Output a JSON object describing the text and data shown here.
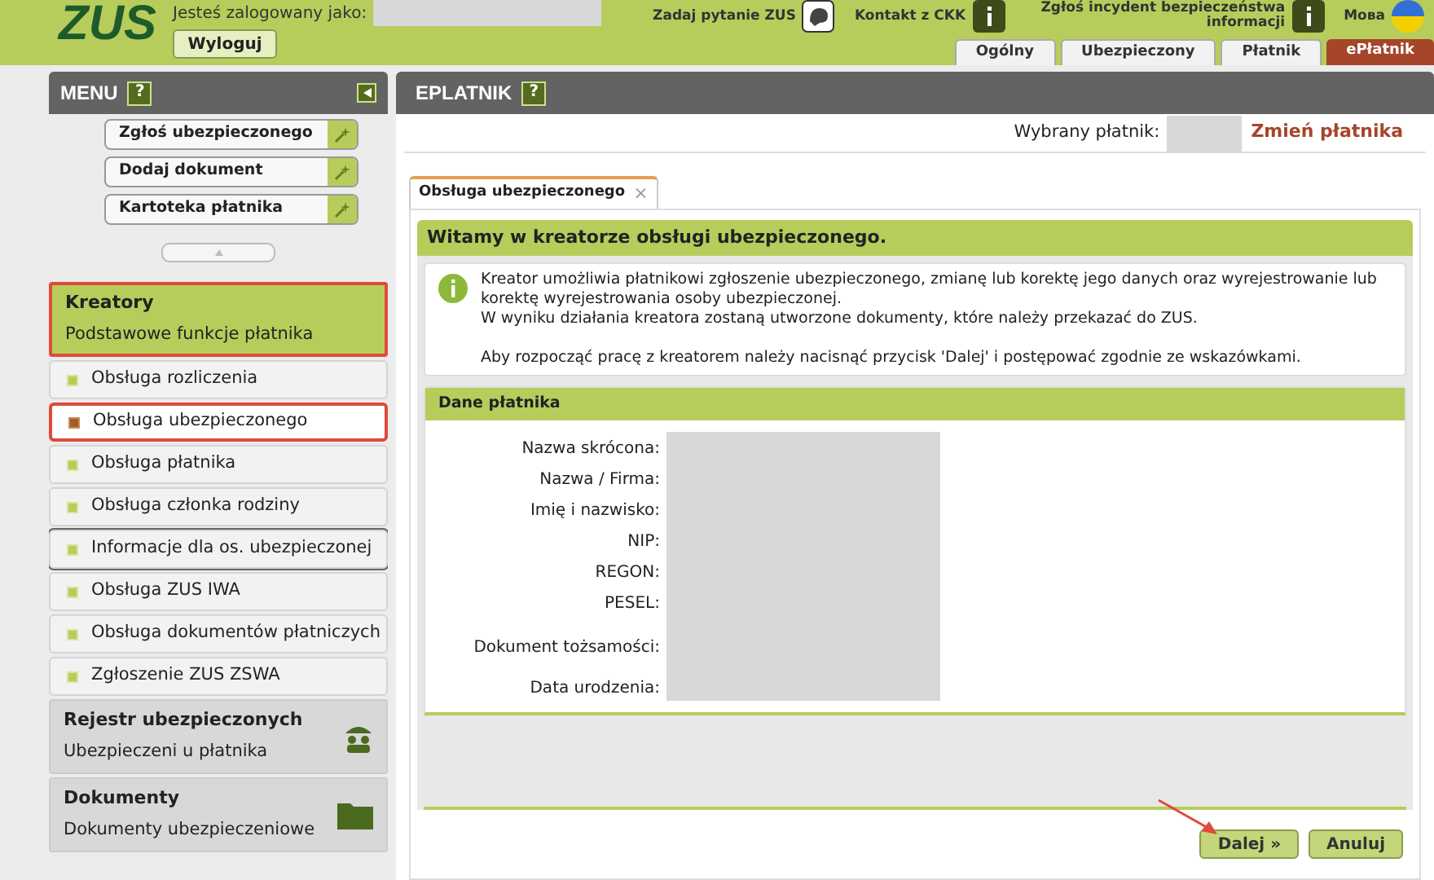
{
  "header": {
    "logo": "ZUS",
    "user_label": "Jesteś zalogowany jako:",
    "logout": "Wyloguj",
    "links": [
      {
        "label": "Zadaj pytanie ZUS",
        "kind": "chat"
      },
      {
        "label": "Kontakt z CKK",
        "kind": "info"
      },
      {
        "label": "Zgłoś incydent bezpieczeństwa informacji",
        "kind": "info"
      },
      {
        "label": "Мова",
        "kind": "flag"
      }
    ],
    "tabs": [
      {
        "label": "Ogólny",
        "selected": false
      },
      {
        "label": "Ubezpieczony",
        "selected": false
      },
      {
        "label": "Płatnik",
        "selected": false
      },
      {
        "label": "ePłatnik",
        "selected": true
      }
    ]
  },
  "sidebar": {
    "title": "MENU",
    "help": "?",
    "quick_actions": [
      "Zgłoś ubezpieczonego",
      "Dodaj dokument",
      "Kartoteka płatnika"
    ],
    "sections": [
      {
        "title": "Kreatory",
        "subtitle": "Podstawowe funkcje płatnika",
        "kind": "none",
        "expanded": true,
        "highlighted": true,
        "items": [
          {
            "label": "Obsługa rozliczenia",
            "selected": false,
            "hovered": false,
            "highlighted": false
          },
          {
            "label": "Obsługa ubezpieczonego",
            "selected": true,
            "hovered": false,
            "highlighted": true
          },
          {
            "label": "Obsługa płatnika",
            "selected": false,
            "hovered": false,
            "highlighted": false
          },
          {
            "label": "Obsługa członka rodziny",
            "selected": false,
            "hovered": false,
            "highlighted": false
          },
          {
            "label": "Informacje dla os. ubezpieczonej",
            "selected": false,
            "hovered": true,
            "highlighted": false
          },
          {
            "label": "Obsługa ZUS IWA",
            "selected": false,
            "hovered": false,
            "highlighted": false
          },
          {
            "label": "Obsługa dokumentów płatniczych",
            "selected": false,
            "hovered": false,
            "highlighted": false
          },
          {
            "label": "Zgłoszenie ZUS ZSWA",
            "selected": false,
            "hovered": false,
            "highlighted": false
          }
        ]
      },
      {
        "title": "Rejestr ubezpieczonych",
        "subtitle": "Ubezpieczeni u płatnika",
        "kind": "people",
        "expanded": false,
        "highlighted": false
      },
      {
        "title": "Dokumenty",
        "subtitle": "Dokumenty ubezpieczeniowe",
        "kind": "folder",
        "expanded": false,
        "highlighted": false
      }
    ]
  },
  "main": {
    "title": "EPLATNIK",
    "help": "?",
    "payer_label": "Wybrany płatnik:",
    "change_payer": "Zmień płatnika",
    "tab": {
      "label": "Obsługa ubezpieczonego",
      "close": "×"
    },
    "wizard_title": "Witamy w kreatorze obsługi ubezpieczonego.",
    "info": [
      "Kreator umożliwia płatnikowi zgłoszenie ubezpieczonego, zmianę lub korektę jego danych oraz wyrejestrowanie lub korektę wyrejestrowania osoby ubezpieczonej.",
      "W wyniku działania kreatora zostaną utworzone dokumenty, które należy przekazać do ZUS.",
      "Aby rozpocząć pracę z kreatorem należy nacisnąć przycisk 'Dalej' i postępować zgodnie ze wskazówkami."
    ],
    "payer_section": {
      "title": "Dane płatnika",
      "fields": [
        "Nazwa skrócona:",
        "Nazwa / Firma:",
        "Imię i nazwisko:",
        "NIP:",
        "REGON:",
        "PESEL:",
        "Dokument tożsamości:",
        "Data urodzenia:"
      ]
    },
    "buttons": [
      {
        "label": "Dalej »"
      },
      {
        "label": "Anuluj"
      }
    ]
  }
}
